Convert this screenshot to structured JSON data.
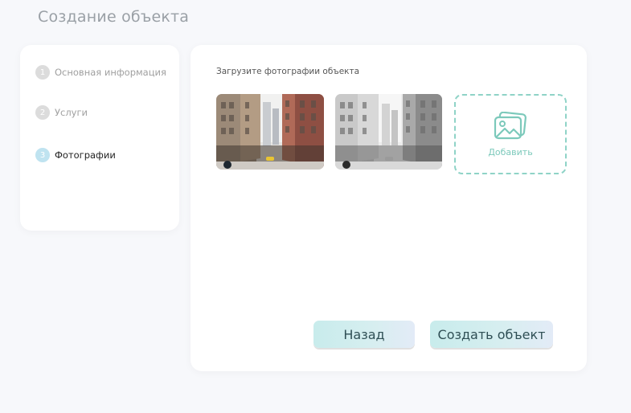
{
  "page": {
    "title": "Создание объекта"
  },
  "steps": [
    {
      "number": "1",
      "label": "Основная информация",
      "active": false
    },
    {
      "number": "2",
      "label": "Услуги",
      "active": false
    },
    {
      "number": "3",
      "label": "Фотографии",
      "active": true
    }
  ],
  "upload": {
    "label": "Загрузите фотографии объекта",
    "add_label": "Добавить",
    "photos": [
      {
        "style": "color"
      },
      {
        "style": "grayscale"
      }
    ]
  },
  "actions": {
    "back_label": "Назад",
    "create_label": "Создать объект"
  },
  "colors": {
    "accent": "#8fd3c7",
    "active_step": "#bfe3f0",
    "background": "#f7f8fb"
  }
}
